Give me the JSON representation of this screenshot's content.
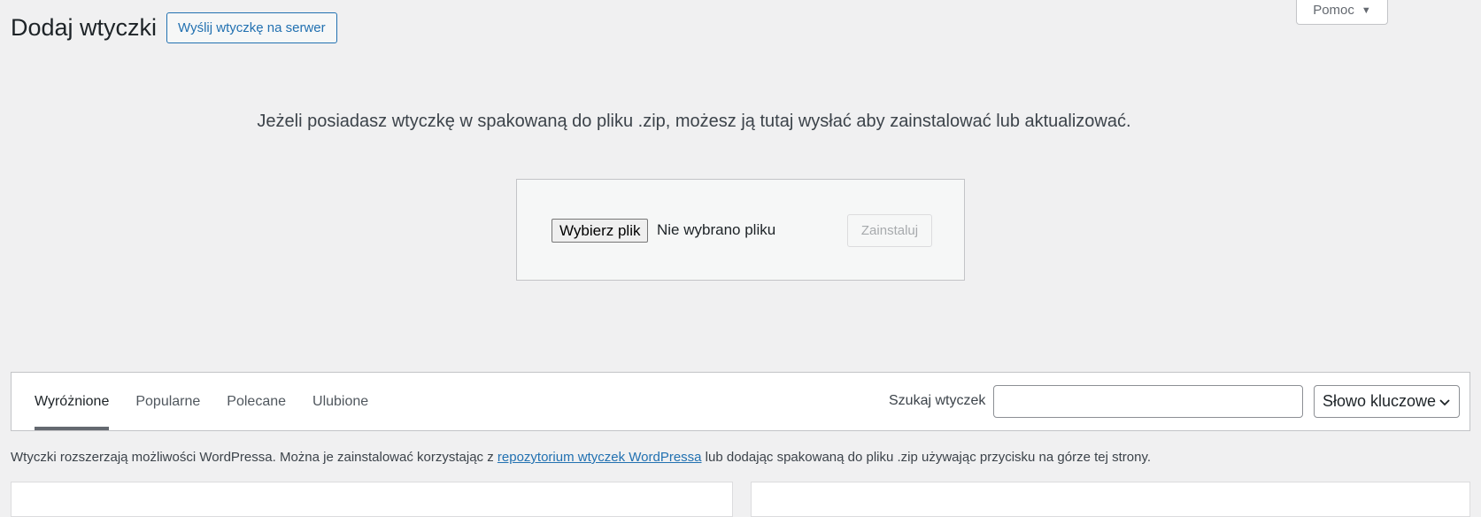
{
  "help_tab": {
    "label": "Pomoc"
  },
  "header": {
    "title": "Dodaj wtyczki",
    "upload_button": "Wyślij wtyczkę na serwer"
  },
  "upload": {
    "description": "Jeżeli posiadasz wtyczkę w spakowaną do pliku .zip, możesz ją tutaj wysłać aby zainstalować lub aktualizować.",
    "choose_file_label": "Wybierz plik",
    "file_status": "Nie wybrano pliku",
    "install_label": "Zainstaluj"
  },
  "filter": {
    "tabs": [
      {
        "label": "Wyróżnione",
        "active": true
      },
      {
        "label": "Popularne",
        "active": false
      },
      {
        "label": "Polecane",
        "active": false
      },
      {
        "label": "Ulubione",
        "active": false
      }
    ],
    "search_label": "Szukaj wtyczek",
    "search_value": "",
    "search_type": "Słowo kluczowe"
  },
  "info": {
    "before_link": "Wtyczki rozszerzają możliwości WordPressa. Można je zainstalować korzystając z ",
    "link_text": "repozytorium wtyczek WordPressa",
    "after_link": " lub dodając spakowaną do pliku .zip używając przycisku na górze tej strony."
  }
}
